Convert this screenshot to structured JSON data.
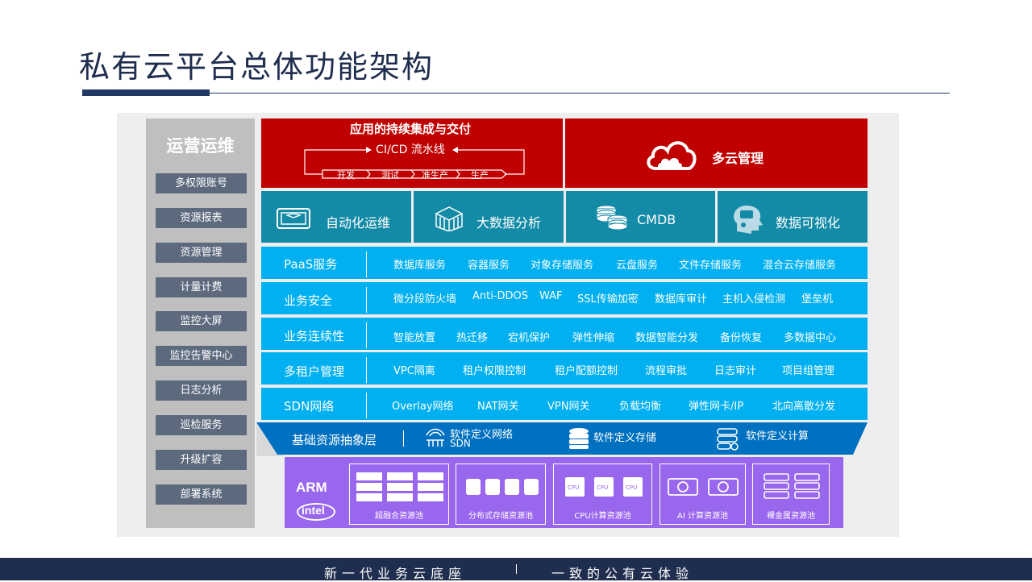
{
  "title": "私有云平台总体功能架构",
  "ops": {
    "title": "运营运维",
    "items": [
      "多权限账号",
      "资源报表",
      "资源管理",
      "计量计费",
      "监控大屏",
      "监控告警中心",
      "日志分析",
      "巡检服务",
      "升级扩容",
      "部署系统"
    ]
  },
  "cicd": {
    "title": "应用的持续集成与交付",
    "pipeline": "CI/CD 流水线",
    "stages": [
      "开发",
      "测试",
      "准生产",
      "生产"
    ]
  },
  "multicloud": {
    "label": "多云管理",
    "icon": "cloud-icon"
  },
  "teal": [
    {
      "label": "自动化运维",
      "icon": "server-box-icon"
    },
    {
      "label": "大数据分析",
      "icon": "cubes-icon"
    },
    {
      "label": "CMDB",
      "icon": "database-icon"
    },
    {
      "label": "数据可视化",
      "icon": "head-icon"
    }
  ],
  "rows": [
    {
      "label": "PaaS服务",
      "items": [
        "数据库服务",
        "容器服务",
        "对象存储服务",
        "云盘服务",
        "文件存储服务",
        "混合云存储服务"
      ]
    },
    {
      "label": "业务安全",
      "items": [
        "微分段防火墙",
        "Anti-DDOS",
        "WAF",
        "SSL传输加密",
        "数据库审计",
        "主机入侵检测",
        "堡垒机"
      ]
    },
    {
      "label": "业务连续性",
      "items": [
        "智能放置",
        "热迁移",
        "宕机保护",
        "弹性伸缩",
        "数据智能分发",
        "备份恢复",
        "多数据中心"
      ]
    },
    {
      "label": "多租户管理",
      "items": [
        "VPC隔离",
        "租户权限控制",
        "租户配额控制",
        "流程审批",
        "日志审计",
        "项目组管理"
      ]
    },
    {
      "label": "SDN网络",
      "items": [
        "Overlay网络",
        "NAT网关",
        "VPN网关",
        "负载均衡",
        "弹性网卡/IP",
        "北向离散分发"
      ]
    }
  ],
  "abstraction": {
    "label": "基础资源抽象层",
    "items": [
      {
        "label": "软件定义网络",
        "sub": "SDN",
        "icon": "network-icon"
      },
      {
        "label": "软件定义存储",
        "sub": "",
        "icon": "storage-icon"
      },
      {
        "label": "软件定义计算",
        "sub": "",
        "icon": "compute-icon"
      }
    ]
  },
  "hardware": {
    "brands": [
      "ARM",
      "intel"
    ],
    "pools": [
      "超融合资源池",
      "分布式存储资源池",
      "CPU计算资源池",
      "AI 计算资源池",
      "裸金属资源池"
    ]
  },
  "footer": {
    "left": "新一代业务云底座",
    "right": "一致的公有云体验"
  },
  "colors": {
    "navy": "#1f2d4e",
    "red": "#c00000",
    "teal": "#138aa6",
    "cyan": "#00b0f0",
    "blue": "#0070c0",
    "purple": "#9966ee",
    "gray": "#5d6a7e"
  }
}
